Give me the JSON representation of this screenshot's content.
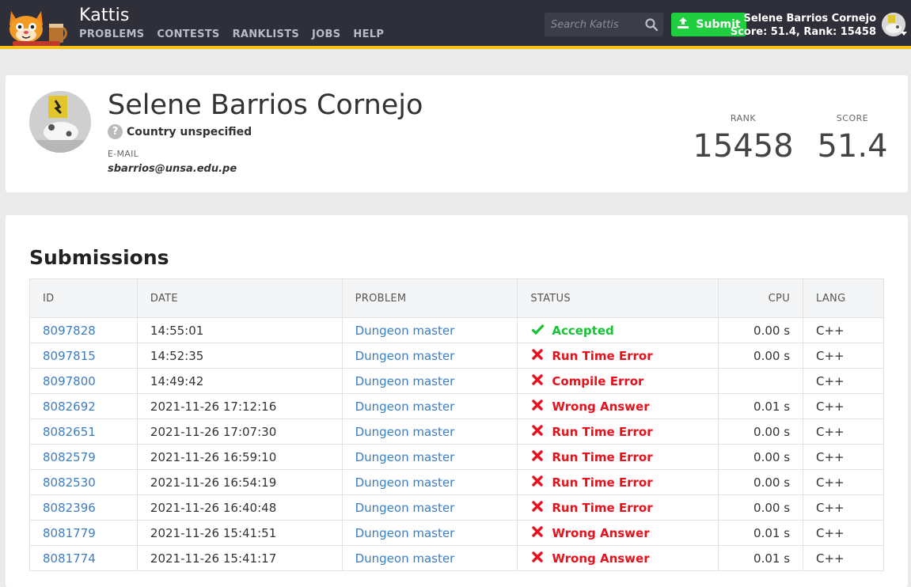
{
  "header": {
    "brand": "Kattis",
    "nav": [
      "PROBLEMS",
      "CONTESTS",
      "RANKLISTS",
      "JOBS",
      "HELP"
    ],
    "search_placeholder": "Search Kattis",
    "submit_label": "Submit",
    "user_name": "Selene Barrios Cornejo",
    "user_stats": "Score: 51.4, Rank: 15458"
  },
  "profile": {
    "name": "Selene Barrios Cornejo",
    "country": "Country unspecified",
    "email_label": "E-MAIL",
    "email": "sbarrios@unsa.edu.pe",
    "rank_label": "RANK",
    "rank": "15458",
    "score_label": "SCORE",
    "score": "51.4"
  },
  "submissions": {
    "title": "Submissions",
    "columns": [
      "ID",
      "DATE",
      "PROBLEM",
      "STATUS",
      "CPU",
      "LANG"
    ],
    "rows": [
      {
        "id": "8097828",
        "date": "14:55:01",
        "problem": "Dungeon master",
        "status": "Accepted",
        "ok": true,
        "cpu": "0.00 s",
        "lang": "C++"
      },
      {
        "id": "8097815",
        "date": "14:52:35",
        "problem": "Dungeon master",
        "status": "Run Time Error",
        "ok": false,
        "cpu": "0.00 s",
        "lang": "C++"
      },
      {
        "id": "8097800",
        "date": "14:49:42",
        "problem": "Dungeon master",
        "status": "Compile Error",
        "ok": false,
        "cpu": "",
        "lang": "C++"
      },
      {
        "id": "8082692",
        "date": "2021-11-26 17:12:16",
        "problem": "Dungeon master",
        "status": "Wrong Answer",
        "ok": false,
        "cpu": "0.01 s",
        "lang": "C++"
      },
      {
        "id": "8082651",
        "date": "2021-11-26 17:07:30",
        "problem": "Dungeon master",
        "status": "Run Time Error",
        "ok": false,
        "cpu": "0.00 s",
        "lang": "C++"
      },
      {
        "id": "8082579",
        "date": "2021-11-26 16:59:10",
        "problem": "Dungeon master",
        "status": "Run Time Error",
        "ok": false,
        "cpu": "0.00 s",
        "lang": "C++"
      },
      {
        "id": "8082530",
        "date": "2021-11-26 16:54:19",
        "problem": "Dungeon master",
        "status": "Run Time Error",
        "ok": false,
        "cpu": "0.00 s",
        "lang": "C++"
      },
      {
        "id": "8082396",
        "date": "2021-11-26 16:40:48",
        "problem": "Dungeon master",
        "status": "Run Time Error",
        "ok": false,
        "cpu": "0.00 s",
        "lang": "C++"
      },
      {
        "id": "8081779",
        "date": "2021-11-26 15:41:51",
        "problem": "Dungeon master",
        "status": "Wrong Answer",
        "ok": false,
        "cpu": "0.01 s",
        "lang": "C++"
      },
      {
        "id": "8081774",
        "date": "2021-11-26 15:41:17",
        "problem": "Dungeon master",
        "status": "Wrong Answer",
        "ok": false,
        "cpu": "0.01 s",
        "lang": "C++"
      }
    ]
  },
  "colors": {
    "nav_bg": "#2f2f3a",
    "nav_accent": "#f7c11a",
    "submit_green": "#1fcf40",
    "link_blue": "#3b7dc4",
    "accepted_green": "#18c235",
    "error_red": "#e8101b"
  },
  "icons": {
    "search": "search-icon",
    "upload": "upload-icon",
    "accepted": "check-icon",
    "error": "cross-icon",
    "country": "question-icon"
  }
}
